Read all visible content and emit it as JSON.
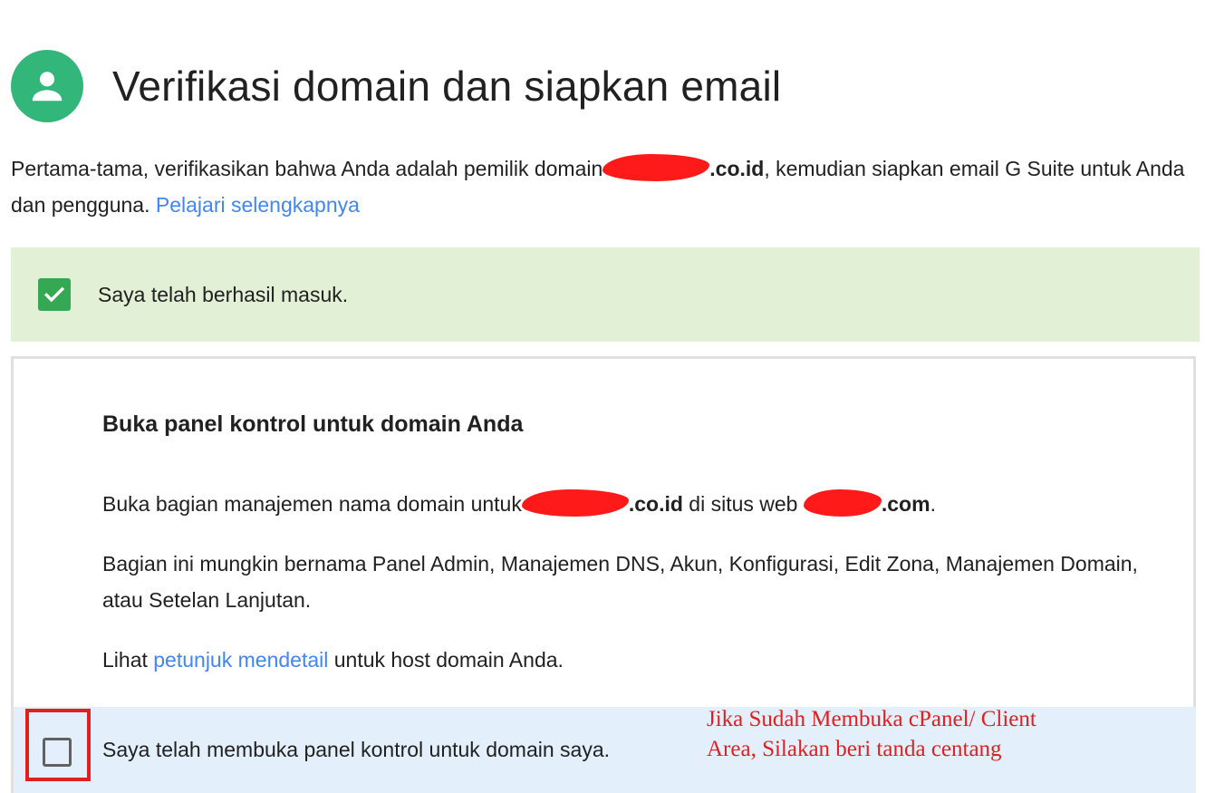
{
  "header": {
    "title": "Verifikasi domain dan siapkan email",
    "avatar_icon": "person-icon",
    "avatar_color": "#33b679"
  },
  "intro": {
    "part1": "Pertama-tama, verifikasikan bahwa Anda adalah pemilik domain",
    "domain_suffix": ".co.id",
    "part2": ", kemudian siapkan email G Suite untuk Anda dan pengguna. ",
    "link": "Pelajari selengkapnya"
  },
  "signed_in": {
    "text": "Saya telah berhasil masuk.",
    "icon": "checkmark-icon",
    "bg_color": "#e2f0d5"
  },
  "card": {
    "title": "Buka panel kontrol untuk domain Anda",
    "p1": {
      "part1": "Buka bagian manajemen nama domain untuk",
      "domain_suffix": ".co.id",
      "part2": " di situs web ",
      "site_suffix": ".com",
      "part3": "."
    },
    "p2": "Bagian ini mungkin bernama Panel Admin, Manajemen DNS, Akun, Konfigurasi, Edit Zona, Manajemen Domain, atau Setelan Lanjutan.",
    "p3": {
      "part1": "Lihat ",
      "link": "petunjuk mendetail",
      "part2": " untuk host domain Anda."
    }
  },
  "confirm": {
    "text": "Saya telah membuka panel kontrol untuk domain saya.",
    "checked": false,
    "bg_color": "#e3f0fb"
  },
  "annotation": {
    "line1": "Jika Sudah Membuka cPanel/ Client",
    "line2": "Area, Silakan beri tanda centang",
    "color": "#e02020"
  }
}
